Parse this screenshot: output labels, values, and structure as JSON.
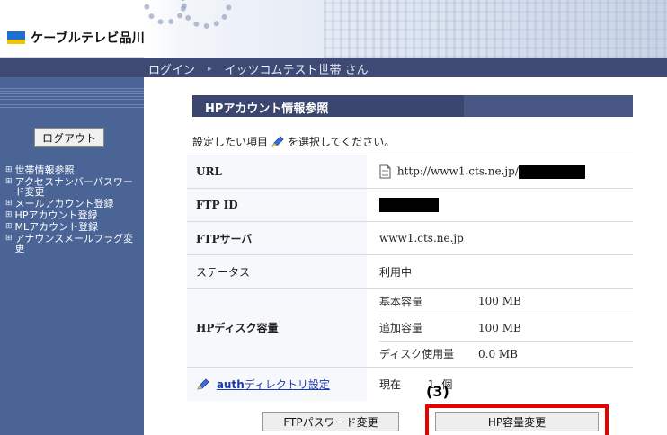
{
  "brand": {
    "name": "ケーブルテレビ品川"
  },
  "topbar": {
    "login_label": "ログイン",
    "separator": "▸",
    "user_name": "イッツコムテスト世帯 さん"
  },
  "sidebar": {
    "logout_label": "ログアウト",
    "items": [
      {
        "label": "世帯情報参照"
      },
      {
        "label": "アクセスナンバーパスワード変更"
      },
      {
        "label": "メールアカウント登録"
      },
      {
        "label": "HPアカウント登録"
      },
      {
        "label": "MLアカウント登録"
      },
      {
        "label": "アナウンスメールフラグ変更"
      }
    ]
  },
  "page": {
    "title": "HPアカウント情報参照",
    "instruction_before": "設定したい項目",
    "instruction_after": "を選択してください。",
    "rows": {
      "url": {
        "label": "URL",
        "value": "http://www1.cts.ne.jp/"
      },
      "ftp_id": {
        "label": "FTP ID"
      },
      "ftp_server": {
        "label": "FTPサーバ",
        "value": "www1.cts.ne.jp"
      },
      "status": {
        "label": "ステータス",
        "value": "利用中"
      },
      "disk": {
        "label": "HPディスク容量",
        "items": [
          {
            "key": "基本容量",
            "value": "100 MB"
          },
          {
            "key": "追加容量",
            "value": "100 MB"
          },
          {
            "key": "ディスク使用量",
            "value": "0.0 MB"
          }
        ]
      },
      "auth": {
        "link_bold": "auth",
        "link_rest": "ディレクトリ設定",
        "current_label": "現在",
        "count": "1",
        "unit": "個"
      }
    },
    "buttons": {
      "ftp_password": "FTPパスワード変更",
      "hp_capacity": "HP容量変更"
    },
    "annotation": {
      "step": "(3)"
    }
  },
  "colors": {
    "nav": "#3e4a73",
    "sidebar": "#4a6496",
    "title_bar": "#3a466e",
    "highlight": "#e60000",
    "link": "#1a3aa8"
  }
}
